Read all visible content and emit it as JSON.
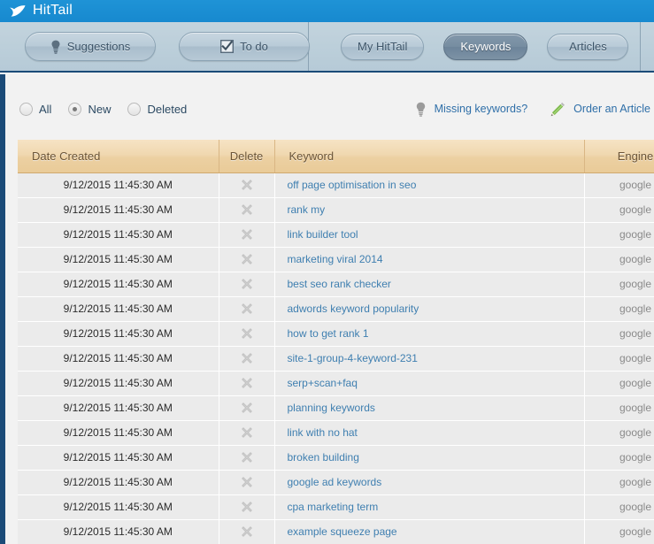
{
  "brand": {
    "name": "HitTail",
    "logo_icon": "tail-swoosh-icon",
    "bar_color": "#1789cf"
  },
  "toolbar": {
    "left_buttons": [
      {
        "label": "Suggestions",
        "icon": "lightbulb-icon",
        "active": false
      },
      {
        "label": "To do",
        "icon": "checkbox-checked-icon",
        "active": false
      }
    ],
    "tabs": [
      {
        "label": "My HitTail",
        "active": false
      },
      {
        "label": "Keywords",
        "active": true
      },
      {
        "label": "Articles",
        "active": false
      }
    ]
  },
  "filters": {
    "radios": [
      {
        "label": "All",
        "selected": false
      },
      {
        "label": "New",
        "selected": true
      },
      {
        "label": "Deleted",
        "selected": false
      }
    ],
    "links": [
      {
        "label": "Missing keywords?",
        "icon": "lightbulb-icon"
      },
      {
        "label": "Order an Article",
        "icon": "pencil-icon"
      }
    ]
  },
  "table": {
    "columns": [
      {
        "key": "date",
        "label": "Date Created"
      },
      {
        "key": "delete",
        "label": "Delete"
      },
      {
        "key": "keyword",
        "label": "Keyword"
      },
      {
        "key": "engine",
        "label": "Engine"
      }
    ],
    "delete_icon": "x-delete-icon",
    "rows": [
      {
        "date": "9/12/2015 11:45:30 AM",
        "keyword": "off page optimisation in seo",
        "engine": "google"
      },
      {
        "date": "9/12/2015 11:45:30 AM",
        "keyword": "rank my",
        "engine": "google"
      },
      {
        "date": "9/12/2015 11:45:30 AM",
        "keyword": "link builder tool",
        "engine": "google"
      },
      {
        "date": "9/12/2015 11:45:30 AM",
        "keyword": "marketing viral 2014",
        "engine": "google"
      },
      {
        "date": "9/12/2015 11:45:30 AM",
        "keyword": "best seo rank checker",
        "engine": "google"
      },
      {
        "date": "9/12/2015 11:45:30 AM",
        "keyword": "adwords keyword popularity",
        "engine": "google"
      },
      {
        "date": "9/12/2015 11:45:30 AM",
        "keyword": "how to get rank 1",
        "engine": "google"
      },
      {
        "date": "9/12/2015 11:45:30 AM",
        "keyword": "site-1-group-4-keyword-231",
        "engine": "google"
      },
      {
        "date": "9/12/2015 11:45:30 AM",
        "keyword": "serp+scan+faq",
        "engine": "google"
      },
      {
        "date": "9/12/2015 11:45:30 AM",
        "keyword": "planning keywords",
        "engine": "google"
      },
      {
        "date": "9/12/2015 11:45:30 AM",
        "keyword": "link with no hat",
        "engine": "google"
      },
      {
        "date": "9/12/2015 11:45:30 AM",
        "keyword": "broken building",
        "engine": "google"
      },
      {
        "date": "9/12/2015 11:45:30 AM",
        "keyword": "google ad keywords",
        "engine": "google"
      },
      {
        "date": "9/12/2015 11:45:30 AM",
        "keyword": "cpa marketing term",
        "engine": "google"
      },
      {
        "date": "9/12/2015 11:45:30 AM",
        "keyword": "example squeeze page",
        "engine": "google"
      }
    ]
  },
  "colors": {
    "brand_blue": "#1789cf",
    "rail_navy": "#1b4b78",
    "header_tan": "#ecd0a2",
    "link_blue": "#3f7fb0",
    "row_gray": "#ebebeb"
  }
}
